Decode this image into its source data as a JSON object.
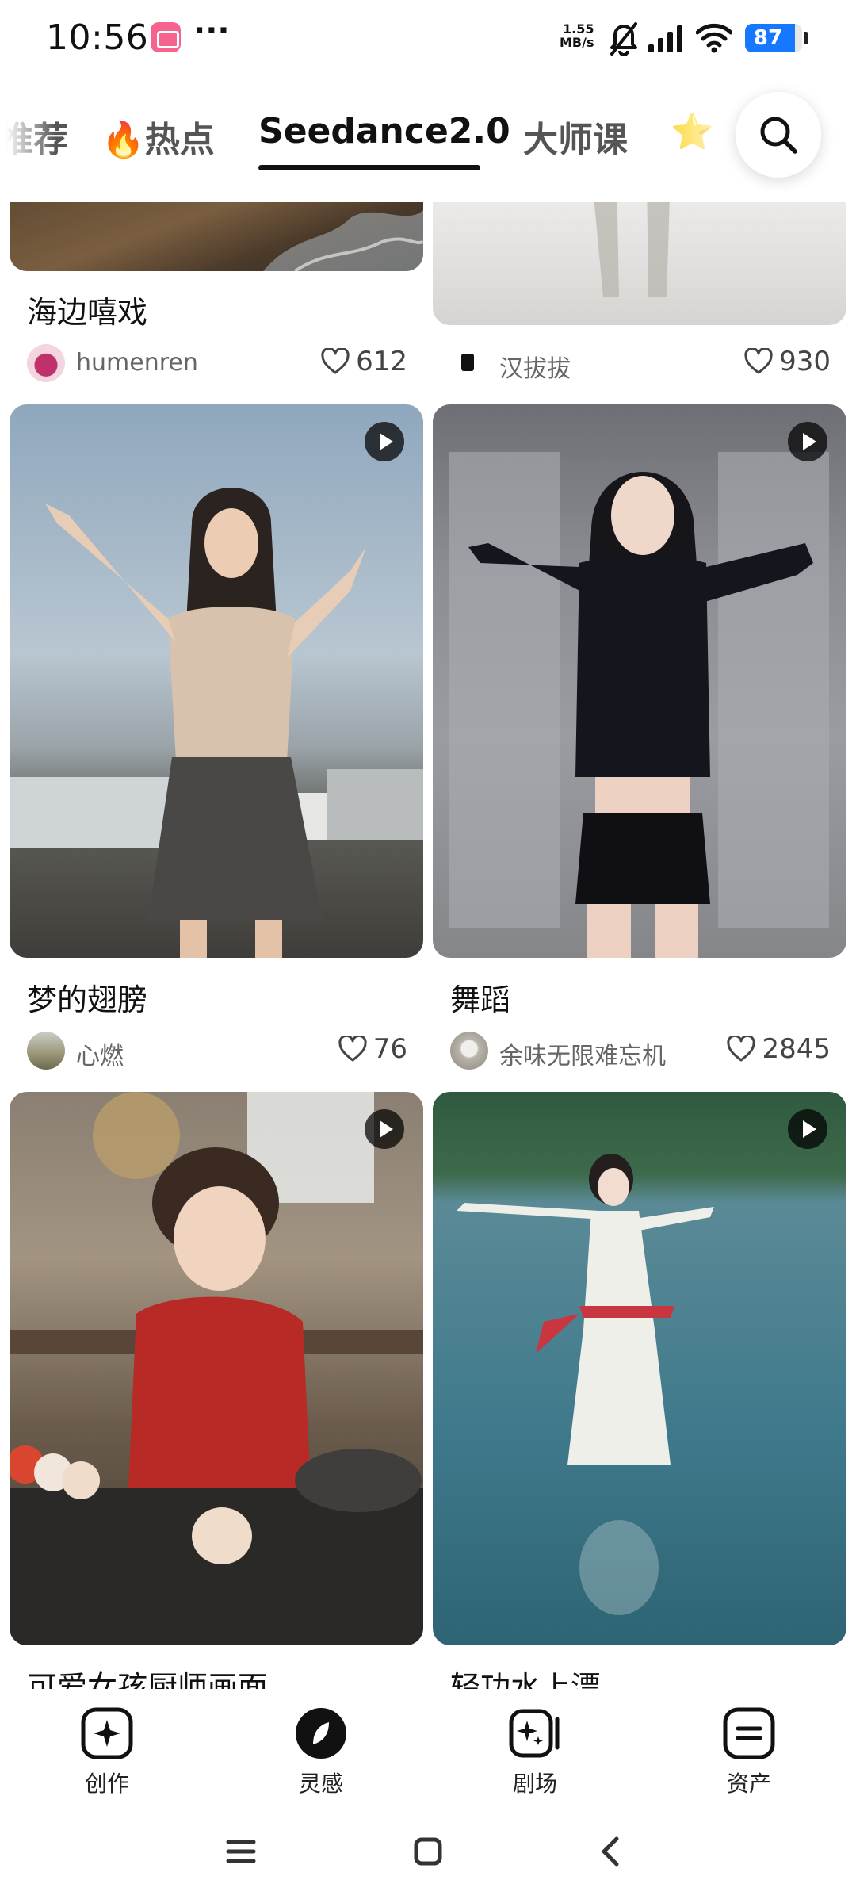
{
  "status_bar": {
    "time": "10:56",
    "more": "···",
    "net_speed_value": "1.55",
    "net_speed_unit": "MB/s",
    "battery_level": "87",
    "battery_color": "#1677ff"
  },
  "tabs": [
    {
      "label": "推荐",
      "active": false
    },
    {
      "label": "🔥热点",
      "active": false
    },
    {
      "label": "Seedance2.0",
      "active": true
    },
    {
      "label": "大师课",
      "active": false
    },
    {
      "label": "⭐",
      "active": false
    }
  ],
  "feed": {
    "cards": [
      {
        "title": "海边嘻戏",
        "author": "humenren",
        "likes": "612",
        "has_video": false
      },
      {
        "title": "",
        "author": "汉拔拔",
        "likes": "930",
        "has_video": false
      },
      {
        "title": "梦的翅膀",
        "author": "心燃",
        "likes": "76",
        "has_video": true
      },
      {
        "title": "舞蹈",
        "author": "余味无限难忘机",
        "likes": "2845",
        "has_video": true
      },
      {
        "title": "可爱女孩厨师画面",
        "author": "",
        "likes": "",
        "has_video": true
      },
      {
        "title": "轻功水上漂",
        "author": "",
        "likes": "",
        "has_video": true
      }
    ]
  },
  "bottom_nav": [
    {
      "label": "创作",
      "icon": "sparkle-square-icon"
    },
    {
      "label": "灵感",
      "icon": "compass-icon",
      "active": true
    },
    {
      "label": "剧场",
      "icon": "theater-icon"
    },
    {
      "label": "资产",
      "icon": "assets-icon"
    }
  ],
  "system_nav": [
    "menu-icon",
    "home-icon",
    "back-icon"
  ]
}
